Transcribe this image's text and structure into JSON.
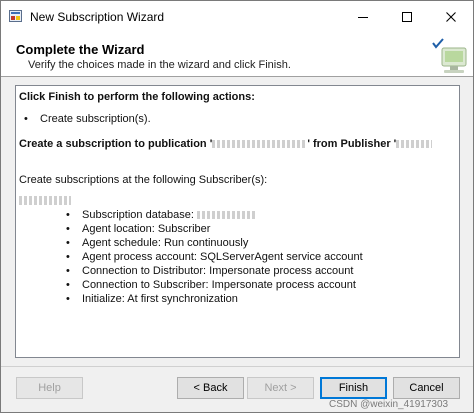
{
  "window": {
    "title": "New Subscription Wizard"
  },
  "header": {
    "title": "Complete the Wizard",
    "subtitle": "Verify the choices made in the wizard and click Finish."
  },
  "summary": {
    "heading": "Click Finish to perform the following actions:",
    "action_item": "Create subscription(s).",
    "publication_prefix": "Create a subscription to publication '",
    "publication_mid": "' from Publisher '",
    "subscribers_line": "Create subscriptions at the following Subscriber(s):",
    "database_label": "Subscription database: ",
    "details": [
      "Agent location: Subscriber",
      "Agent schedule: Run continuously",
      "Agent process account: SQLServerAgent service account",
      "Connection to Distributor: Impersonate process account",
      "Connection to Subscriber: Impersonate process account",
      "Initialize: At first synchronization"
    ]
  },
  "buttons": {
    "help": "Help",
    "back": "< Back",
    "next": "Next >",
    "finish": "Finish",
    "cancel": "Cancel"
  },
  "watermark": "CSDN @weixin_41917303",
  "icons": {
    "app": "wizard-app-icon",
    "header_art": "check-computer-icon"
  }
}
